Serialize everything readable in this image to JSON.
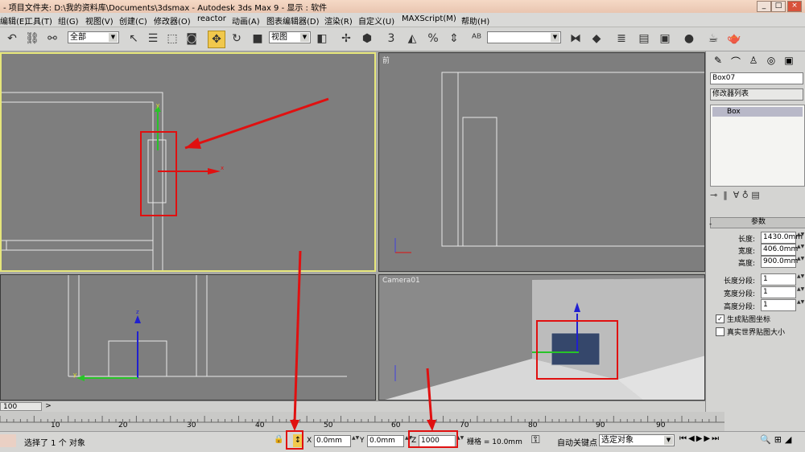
{
  "window": {
    "title": "- 项目文件夹: D:\\我的资料库\\Documents\\3dsmax     - Autodesk 3ds Max 9     - 显示 : 软件",
    "min": "_",
    "max": "□",
    "close": "×"
  },
  "menu": [
    "编辑(E)",
    "工具(T)",
    "组(G)",
    "视图(V)",
    "创建(C)",
    "修改器(O)",
    "reactor",
    "动画(A)",
    "图表编辑器(D)",
    "渲染(R)",
    "自定义(U)",
    "MAXScript(M)",
    "帮助(H)"
  ],
  "toolbar": {
    "selection_filter": "全部",
    "ref_coord": "视图",
    "named_selection": ""
  },
  "viewports": {
    "front": "前",
    "camera": "Camera01"
  },
  "command_panel": {
    "object_name": "Box07",
    "modifier_list_label": "修改器列表",
    "stack_item": "Box",
    "rollout_title": "参数",
    "params": [
      {
        "label": "长度:",
        "value": "1430.0mm"
      },
      {
        "label": "宽度:",
        "value": "406.0mm"
      },
      {
        "label": "高度:",
        "value": "900.0mm"
      },
      {
        "label": "长度分段:",
        "value": "1"
      },
      {
        "label": "宽度分段:",
        "value": "1"
      },
      {
        "label": "高度分段:",
        "value": "1"
      }
    ],
    "gen_mapping": "生成贴图坐标",
    "real_world": "真实世界贴图大小"
  },
  "timeline": {
    "frame": "100",
    "next": ">"
  },
  "track_ticks": [
    "10",
    "20",
    "30",
    "40",
    "50",
    "60",
    "70",
    "80",
    "90",
    "90"
  ],
  "status": {
    "selection_text": "选择了 1 个 对象",
    "x_label": "X",
    "x_value": "0.0mm",
    "y_label": "Y",
    "y_value": "0.0mm",
    "z_label": "Z",
    "z_value": "1000",
    "grid": "栅格 = 10.0mm",
    "auto_key": "自动关键点",
    "key_mode": "选定对象"
  },
  "colors": {
    "annotation": "#e01010",
    "active_border": "#e6e67a"
  }
}
